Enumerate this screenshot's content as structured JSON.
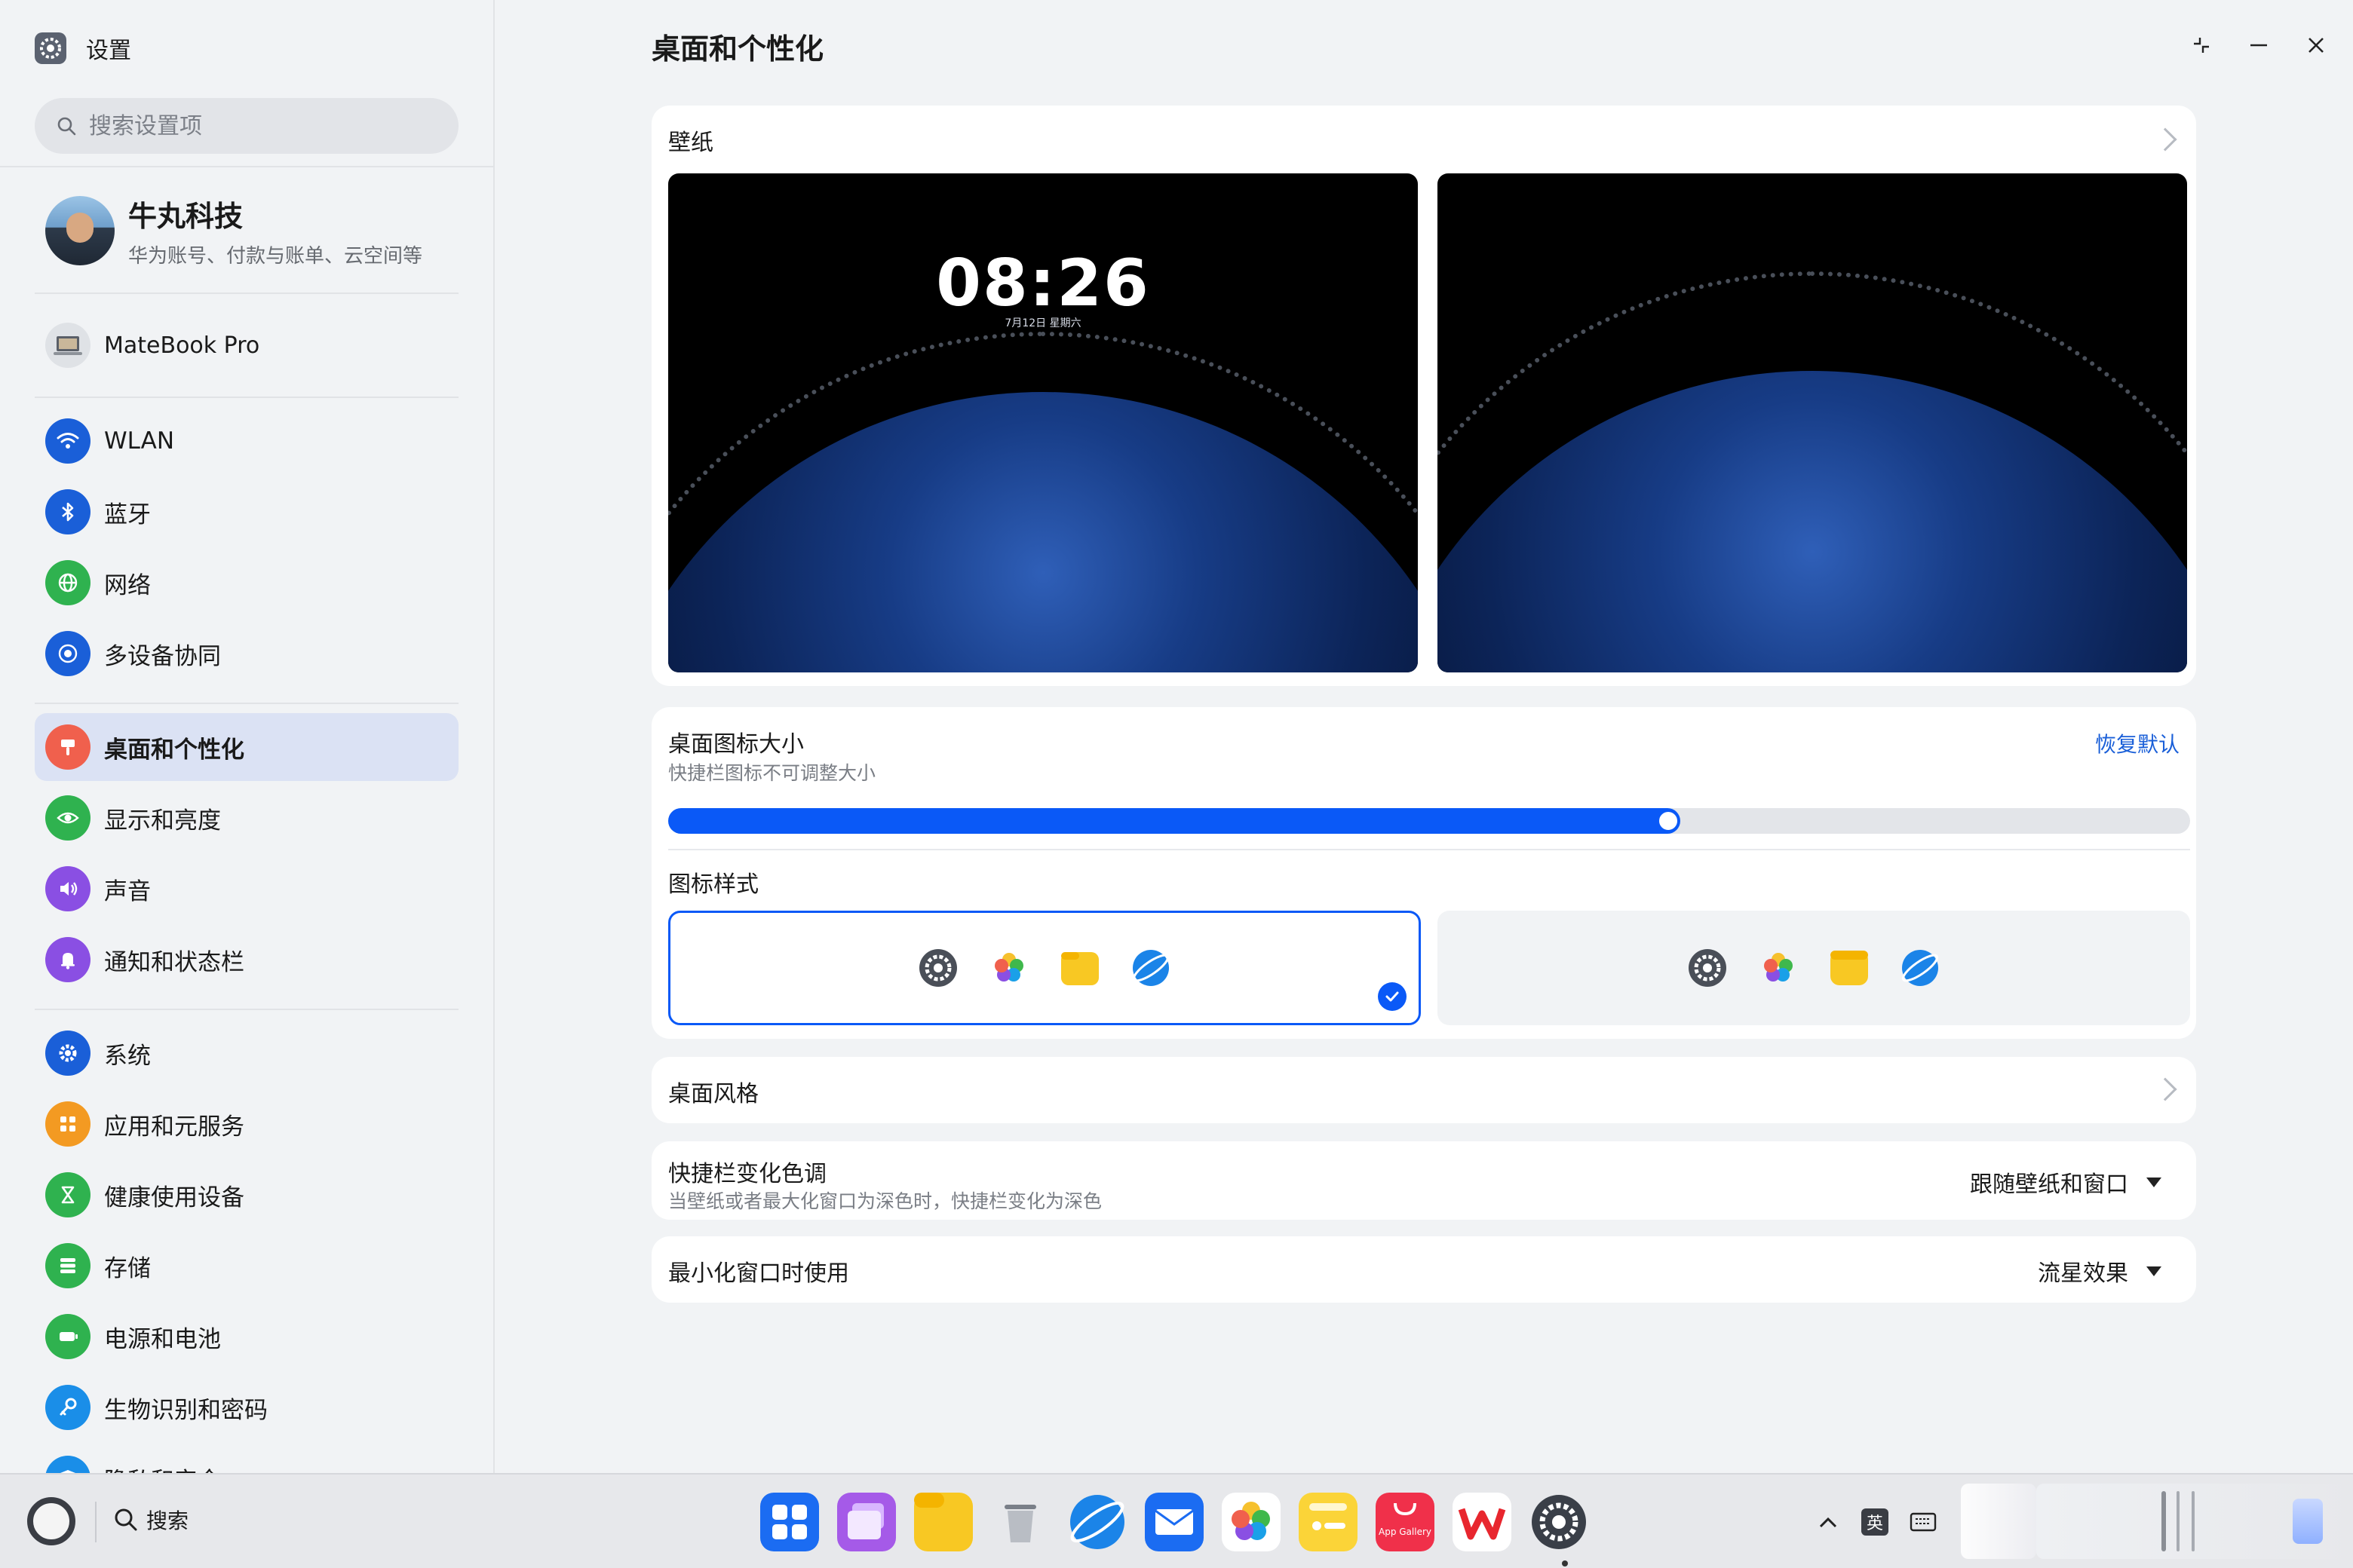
{
  "window": {
    "app_title": "设置",
    "page_title": "桌面和个性化",
    "controls": {
      "restore": "restore",
      "minimize": "minimize",
      "close": "close"
    }
  },
  "sidebar": {
    "search_placeholder": "搜索设置项",
    "account": {
      "name": "牛丸科技",
      "subtitle": "华为账号、付款与账单、云空间等"
    },
    "device": {
      "name": "MateBook Pro"
    },
    "items": [
      {
        "label": "WLAN",
        "icon": "wifi-icon",
        "color": "#1a5fd8"
      },
      {
        "label": "蓝牙",
        "icon": "bluetooth-icon",
        "color": "#1a5fd8"
      },
      {
        "label": "网络",
        "icon": "globe-icon",
        "color": "#2fb24f"
      },
      {
        "label": "多设备协同",
        "icon": "collaboration-icon",
        "color": "#1a5fd8"
      },
      {
        "label": "桌面和个性化",
        "icon": "brush-icon",
        "color": "#f0604d",
        "active": true
      },
      {
        "label": "显示和亮度",
        "icon": "eye-icon",
        "color": "#2fb24f"
      },
      {
        "label": "声音",
        "icon": "speaker-icon",
        "color": "#8a4fe3"
      },
      {
        "label": "通知和状态栏",
        "icon": "bell-icon",
        "color": "#8a4fe3"
      },
      {
        "label": "系统",
        "icon": "gear-icon",
        "color": "#1a5fd8"
      },
      {
        "label": "应用和元服务",
        "icon": "apps-icon",
        "color": "#f39a22"
      },
      {
        "label": "健康使用设备",
        "icon": "hourglass-icon",
        "color": "#2fb24f"
      },
      {
        "label": "存储",
        "icon": "storage-icon",
        "color": "#2fb24f"
      },
      {
        "label": "电源和电池",
        "icon": "battery-icon",
        "color": "#2fb24f"
      },
      {
        "label": "生物识别和密码",
        "icon": "key-icon",
        "color": "#1a8ee8"
      },
      {
        "label": "隐私和安全",
        "icon": "shield-icon",
        "color": "#1a8ee8"
      }
    ]
  },
  "wallpaper": {
    "label": "壁纸",
    "lock_time": "08:26",
    "lock_date": "7月12日 星期六"
  },
  "icon_size": {
    "title": "桌面图标大小",
    "subtitle": "快捷栏图标不可调整大小",
    "reset_label": "恢复默认",
    "level": 0.665,
    "accent": "#0a59f7"
  },
  "icon_style": {
    "title": "图标样式",
    "options": [
      {
        "icons": [
          "settings-icon",
          "photos-icon",
          "files-icon",
          "browser-icon"
        ],
        "selected": true
      },
      {
        "icons": [
          "settings-icon",
          "photos-icon",
          "files-icon",
          "browser-icon"
        ],
        "selected": false
      }
    ]
  },
  "desktop_style": {
    "label": "桌面风格"
  },
  "dock_color": {
    "label": "快捷栏变化色调",
    "subtitle": "当壁纸或者最大化窗口为深色时，快捷栏变化为深色",
    "value": "跟随壁纸和窗口"
  },
  "minimize_effect": {
    "label": "最小化窗口时使用",
    "value": "流星效果"
  },
  "taskbar": {
    "search_label": "搜索",
    "apps": [
      "app-center-icon",
      "multitask-icon",
      "files-icon",
      "trash-icon",
      "browser-icon",
      "mail-icon",
      "photos-icon",
      "notes-icon",
      "appgallery-icon",
      "wps-icon",
      "settings-icon"
    ],
    "appgallery_text": "App Gallery",
    "ime": "英"
  }
}
